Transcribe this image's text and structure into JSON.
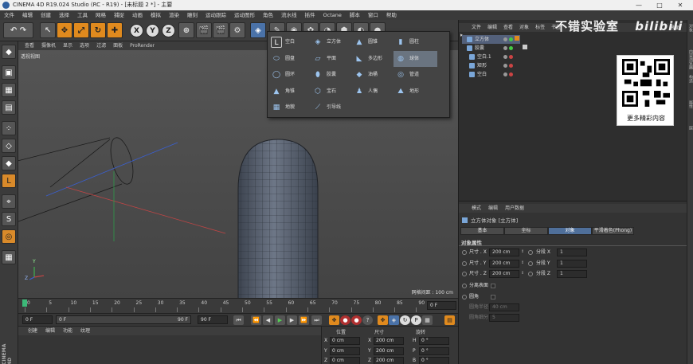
{
  "window": {
    "title": "CINEMA 4D R19.024 Studio (RC - R19) - [未标题 2 *] - 主要"
  },
  "menu": [
    "文件",
    "编辑",
    "创建",
    "选择",
    "工具",
    "网格",
    "捕捉",
    "动画",
    "模拟",
    "渲染",
    "雕刻",
    "运动跟踪",
    "运动图形",
    "角色",
    "流水线",
    "插件",
    "Octane",
    "脚本",
    "窗口",
    "帮助"
  ],
  "toolbar": {
    "axis_x": "X",
    "axis_y": "Y",
    "axis_z": "Z"
  },
  "viewport": {
    "menu": [
      "查看",
      "摄像机",
      "显示",
      "选项",
      "过滤",
      "面板",
      "ProRender"
    ],
    "label": "透视视图",
    "grid_info": "网格间距 : 100 cm",
    "axis_y": "Y",
    "axis_z": "Z"
  },
  "primitives_popup": {
    "items": [
      {
        "label": "空白",
        "icon": "null-icon"
      },
      {
        "label": "立方体",
        "icon": "cube-icon"
      },
      {
        "label": "圆锥",
        "icon": "cone-icon"
      },
      {
        "label": "圆柱",
        "icon": "cylinder-icon"
      },
      {
        "label": "圆盘",
        "icon": "disc-icon"
      },
      {
        "label": "平面",
        "icon": "plane-icon"
      },
      {
        "label": "多边形",
        "icon": "polygon-icon"
      },
      {
        "label": "球体",
        "icon": "sphere-icon"
      },
      {
        "label": "圆环",
        "icon": "torus-icon"
      },
      {
        "label": "胶囊",
        "icon": "capsule-icon"
      },
      {
        "label": "油桶",
        "icon": "oil-tank-icon"
      },
      {
        "label": "管道",
        "icon": "tube-icon"
      },
      {
        "label": "角锥",
        "icon": "pyramid-icon"
      },
      {
        "label": "宝石",
        "icon": "gem-icon"
      },
      {
        "label": "人偶",
        "icon": "figure-icon"
      },
      {
        "label": "地形",
        "icon": "landscape-icon"
      },
      {
        "label": "地貌",
        "icon": "relief-icon"
      },
      {
        "label": "引导线",
        "icon": "guide-icon"
      }
    ],
    "selected": "球体"
  },
  "timeline": {
    "ticks": [
      "0",
      "5",
      "10",
      "15",
      "20",
      "25",
      "30",
      "35",
      "40",
      "45",
      "50",
      "55",
      "60",
      "65",
      "70",
      "75",
      "80",
      "85",
      "90"
    ],
    "current_frame": "0 F",
    "start": "0 F",
    "end": "90 F",
    "range_start": "0 F",
    "range_end": "90 F"
  },
  "materials": {
    "menu": [
      "创建",
      "编辑",
      "功能",
      "纹理"
    ],
    "logo": "CINEMA 4D"
  },
  "coords": {
    "headers": [
      "位置",
      "尺寸",
      "旋转"
    ],
    "rows": [
      {
        "axis": "X",
        "pos": "0 cm",
        "size": "200 cm",
        "rot_axis": "H",
        "rot": "0 °"
      },
      {
        "axis": "Y",
        "pos": "0 cm",
        "size": "200 cm",
        "rot_axis": "P",
        "rot": "0 °"
      },
      {
        "axis": "Z",
        "pos": "0 cm",
        "size": "200 cm",
        "rot_axis": "B",
        "rot": "0 °"
      }
    ]
  },
  "objects": {
    "menu": [
      "文件",
      "编辑",
      "查看",
      "对象",
      "标签",
      "书签"
    ],
    "items": [
      "立方体",
      "胶囊",
      "空白.1",
      "矩形",
      "空白"
    ],
    "layout_label": "界面"
  },
  "attributes": {
    "menu": [
      "模式",
      "编辑",
      "用户数据"
    ],
    "title": "立方体对象 [立方体]",
    "tabs": [
      "基本",
      "坐标",
      "对象",
      "平滑着色(Phong)"
    ],
    "active_tab": "对象",
    "section": "对象属性",
    "rows": [
      {
        "label": "尺寸 . X",
        "value": "200 cm",
        "seg_label": "分段 X",
        "seg": "1"
      },
      {
        "label": "尺寸 . Y",
        "value": "200 cm",
        "seg_label": "分段 Y",
        "seg": "1"
      },
      {
        "label": "尺寸 . Z",
        "value": "200 cm",
        "seg_label": "分段 Z",
        "seg": "1"
      }
    ],
    "separate_surfaces": "分离表面",
    "fillet": "圆角",
    "fillet_radius_label": "圆角半径",
    "fillet_radius": "40 cm",
    "fillet_subdiv_label": "圆角细分",
    "fillet_subdiv": "5"
  },
  "side_tabs": [
    "对象",
    "内容浏览器",
    "构造",
    "属性",
    "层"
  ],
  "overlay": {
    "watermark": "不错实验室",
    "qr_caption": "更多精彩内容",
    "bilibili": "bilibili"
  },
  "colors": {
    "accent": "#e08a1e",
    "selection": "#6a7480",
    "tab_active": "#4f6f9a"
  }
}
